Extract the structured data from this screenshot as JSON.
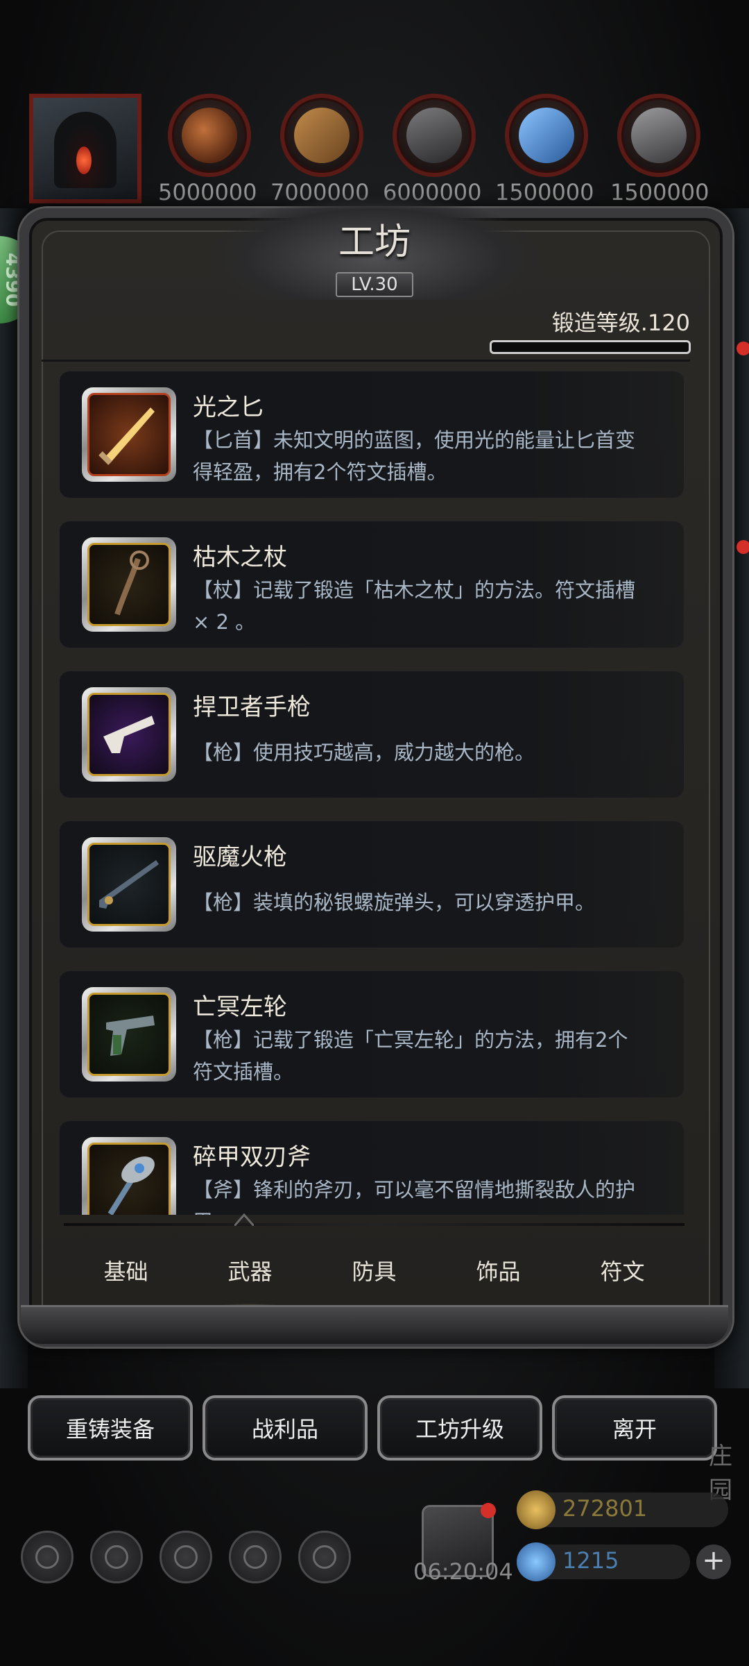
{
  "resources": [
    {
      "icon": "portrait-icon",
      "amount": ""
    },
    {
      "icon": "ore-icon",
      "amount": "5000000"
    },
    {
      "icon": "wood-icon",
      "amount": "7000000"
    },
    {
      "icon": "iron-icon",
      "amount": "6000000"
    },
    {
      "icon": "crystal-icon",
      "amount": "1500000"
    },
    {
      "icon": "steel-icon",
      "amount": "1500000"
    }
  ],
  "side_badge": "4390",
  "panel": {
    "title": "工坊",
    "level": "LV.30",
    "forge_level": "锻造等级.120",
    "forge_progress": 0
  },
  "items": [
    {
      "name": "光之匕",
      "desc": "【匕首】未知文明的蓝图，使用光的能量让匕首变得轻盈，拥有2个符文插槽。",
      "icon": "dagger-icon",
      "frame": "#b5421e"
    },
    {
      "name": "枯木之杖",
      "desc": "【杖】记载了锻造「枯木之杖」的方法。符文插槽× 2 。",
      "icon": "staff-icon",
      "frame": "#c79a2e"
    },
    {
      "name": "捍卫者手枪",
      "desc": "【枪】使用技巧越高，威力越大的枪。",
      "icon": "pistol-icon",
      "frame": "#c79a2e"
    },
    {
      "name": "驱魔火枪",
      "desc": "【枪】装填的秘银螺旋弹头，可以穿透护甲。",
      "icon": "musket-icon",
      "frame": "#c79a2e"
    },
    {
      "name": "亡冥左轮",
      "desc": "【枪】记载了锻造「亡冥左轮」的方法，拥有2个符文插槽。",
      "icon": "revolver-icon",
      "frame": "#c79a2e"
    },
    {
      "name": "碎甲双刃斧",
      "desc": "【斧】锋利的斧刃，可以毫不留情地撕裂敌人的护甲。",
      "icon": "axe-icon",
      "frame": "#c79a2e"
    }
  ],
  "tabs": [
    {
      "label": "基础",
      "active": false
    },
    {
      "label": "武器",
      "active": true
    },
    {
      "label": "防具",
      "active": false
    },
    {
      "label": "饰品",
      "active": false
    },
    {
      "label": "符文",
      "active": false
    }
  ],
  "actions": {
    "reforge": "重铸装备",
    "loot": "战利品",
    "upgrade": "工坊升级",
    "leave": "离开"
  },
  "bottom": {
    "timer": "06:20:04",
    "gold": "272801",
    "gems": "1215",
    "right_text": "庄园"
  },
  "colors": {
    "gold_text": "#8c7a3a",
    "gem_text": "#4a7fb0",
    "red": "#d52f2a",
    "desc_blue": "#a9b7c6"
  }
}
